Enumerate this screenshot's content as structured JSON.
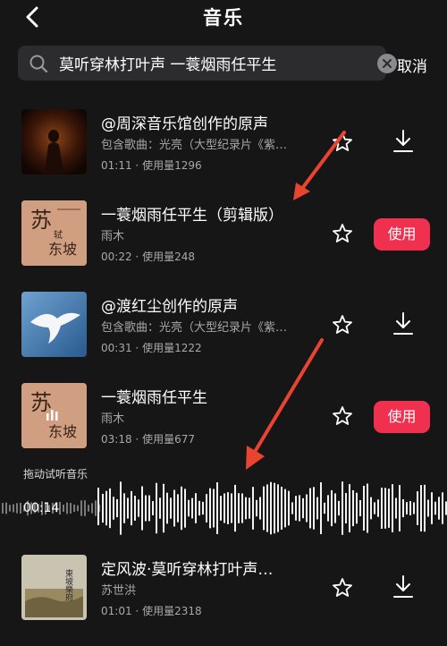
{
  "header": {
    "title": "音乐",
    "back_icon": "back-chevron-icon"
  },
  "search": {
    "query": "莫听穿林打叶声 一蓑烟雨任平生",
    "cancel_label": "取消"
  },
  "results": [
    {
      "title": "@周深音乐馆创作的原声",
      "subtitle": "包含歌曲：光亮（大型纪录片《紫…",
      "duration": "01:11",
      "usage": "使用量1296",
      "action": "download"
    },
    {
      "title": "一蓑烟雨任平生（剪辑版）",
      "subtitle": "雨木",
      "duration": "00:22",
      "usage": "使用量248",
      "action": "use",
      "action_label": "使用"
    },
    {
      "title": "@渡红尘创作的原声",
      "subtitle": "包含歌曲：光亮（大型纪录片《紫…",
      "duration": "00:31",
      "usage": "使用量1222",
      "action": "download"
    },
    {
      "title": "一蓑烟雨任平生",
      "subtitle": "雨木",
      "duration": "03:18",
      "usage": "使用量677",
      "action": "use",
      "action_label": "使用"
    },
    {
      "title": "定风波·莫听穿林打叶声…",
      "subtitle": "苏世洪",
      "duration": "01:01",
      "usage": "使用量2318",
      "action": "download"
    }
  ],
  "preview": {
    "label": "拖动试听音乐",
    "time": "00:14"
  },
  "covers": {
    "su_title": "苏",
    "su_sub1": "轼",
    "su_sub2": "东坡",
    "poem_chars": "東坡樂府"
  },
  "meta_sep": "·",
  "colors": {
    "accent": "#f0304f",
    "background": "#161616",
    "annotation": "#e8442f"
  }
}
